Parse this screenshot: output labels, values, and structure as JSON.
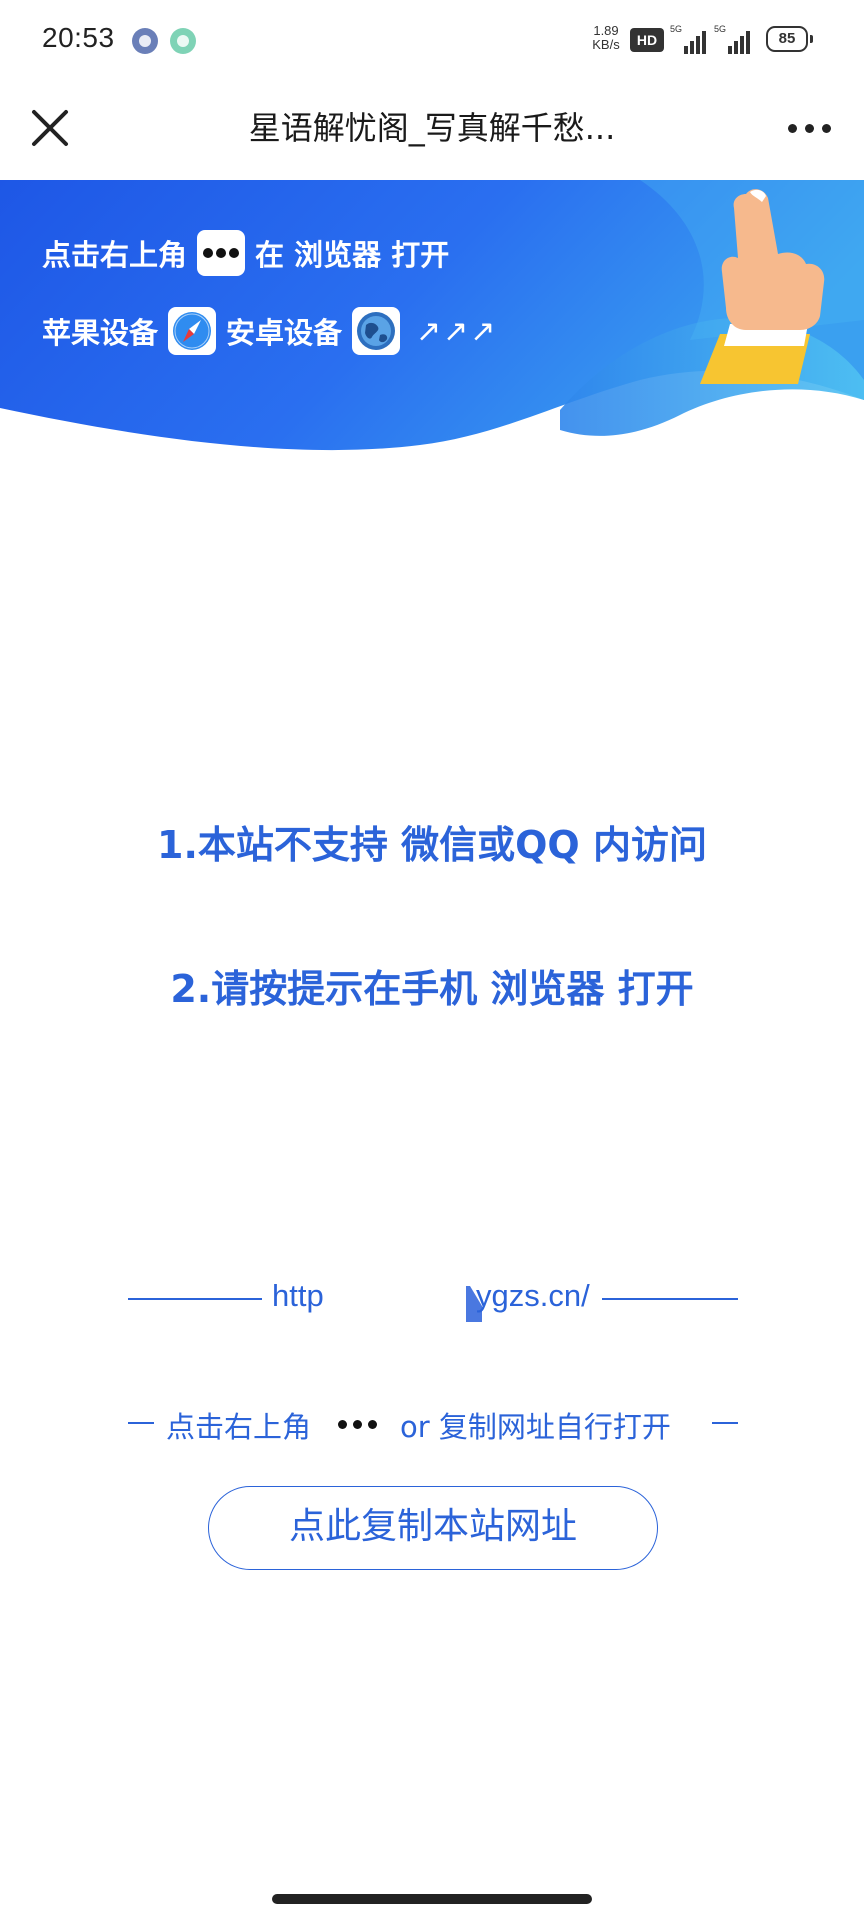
{
  "status_bar": {
    "time": "20:53",
    "net_speed_value": "1.89",
    "net_speed_unit": "KB/s",
    "hd_label": "HD",
    "network_1": "5G",
    "network_2": "5G",
    "battery_level": "85"
  },
  "nav": {
    "title": "星语解忧阁_写真解千愁..."
  },
  "banner": {
    "line1_prefix": "点击右上角",
    "line1_suffix": "在 浏览器 打开",
    "line2_apple": "苹果设备",
    "line2_android": "安卓设备",
    "arrows": "↗↗↗",
    "colors": {
      "gradient_start": "#1e57e6",
      "gradient_end": "#3aa0f0",
      "accent_yellow": "#f7c531"
    }
  },
  "main": {
    "line1": "1.本站不支持 微信或QQ 内访问",
    "line2": "2.请按提示在手机 浏览器 打开"
  },
  "url": {
    "left_text": "http",
    "right_text": "ygzs.cn/"
  },
  "hint": {
    "prefix": "点击右上角",
    "suffix": "or 复制网址自行打开"
  },
  "copy_button": {
    "label": "点此复制本站网址"
  },
  "theme": {
    "primary_blue": "#2b63d9",
    "text_dark": "#1a1a1a"
  },
  "icons": {
    "close": "close-icon",
    "more": "more-icon",
    "safari": "safari-compass-icon",
    "android_browser": "globe-icon",
    "pointing_hand": "pointing-hand-icon"
  }
}
